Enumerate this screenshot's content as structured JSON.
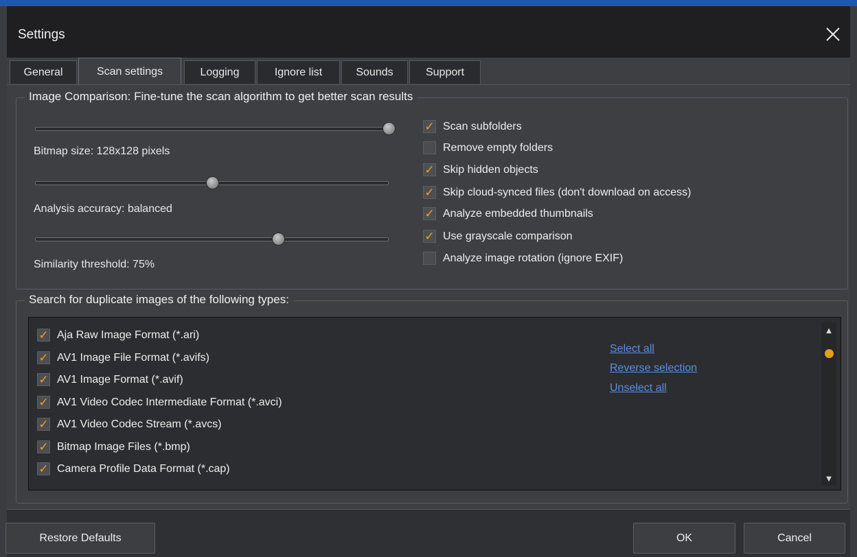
{
  "window": {
    "title": "Settings",
    "close_icon": "close-icon"
  },
  "tabs": [
    {
      "label": "General"
    },
    {
      "label": "Scan settings",
      "active": true
    },
    {
      "label": "Logging"
    },
    {
      "label": "Ignore list"
    },
    {
      "label": "Sounds"
    },
    {
      "label": "Support"
    }
  ],
  "image_comparison": {
    "legend": "Image Comparison: Fine-tune the scan algorithm to get better scan results",
    "sliders": [
      {
        "label": "Bitmap size: 128x128 pixels",
        "value": 1.0
      },
      {
        "label": "Analysis accuracy: balanced",
        "value": 0.5
      },
      {
        "label": "Similarity threshold: 75%",
        "value": 0.69
      }
    ],
    "options": [
      {
        "label": "Scan subfolders",
        "checked": true
      },
      {
        "label": "Remove empty folders",
        "checked": false
      },
      {
        "label": "Skip hidden objects",
        "checked": true
      },
      {
        "label": "Skip cloud-synced files (don't download on access)",
        "checked": true
      },
      {
        "label": "Analyze embedded thumbnails",
        "checked": true
      },
      {
        "label": "Use grayscale comparison",
        "checked": true
      },
      {
        "label": "Analyze image rotation (ignore EXIF)",
        "checked": false
      }
    ]
  },
  "types": {
    "legend": "Search for duplicate images of the following types:",
    "items": [
      {
        "label": "Aja Raw Image Format (*.ari)",
        "checked": true
      },
      {
        "label": "AV1 Image File Format (*.avifs)",
        "checked": true
      },
      {
        "label": "AV1 Image Format (*.avif)",
        "checked": true
      },
      {
        "label": "AV1 Video Codec Intermediate Format (*.avci)",
        "checked": true
      },
      {
        "label": "AV1 Video Codec Stream (*.avcs)",
        "checked": true
      },
      {
        "label": "Bitmap Image Files (*.bmp)",
        "checked": true
      },
      {
        "label": "Camera Profile Data Format (*.cap)",
        "checked": true
      }
    ],
    "links": {
      "select_all": "Select all",
      "reverse": "Reverse selection",
      "unselect_all": "Unselect all"
    }
  },
  "buttons": {
    "restore": "Restore Defaults",
    "ok": "OK",
    "cancel": "Cancel"
  },
  "check_glyph": "✓",
  "colors": {
    "accent_check": "#f0a020",
    "link": "#5b8fe0",
    "title_bar": "#1f1f21"
  }
}
